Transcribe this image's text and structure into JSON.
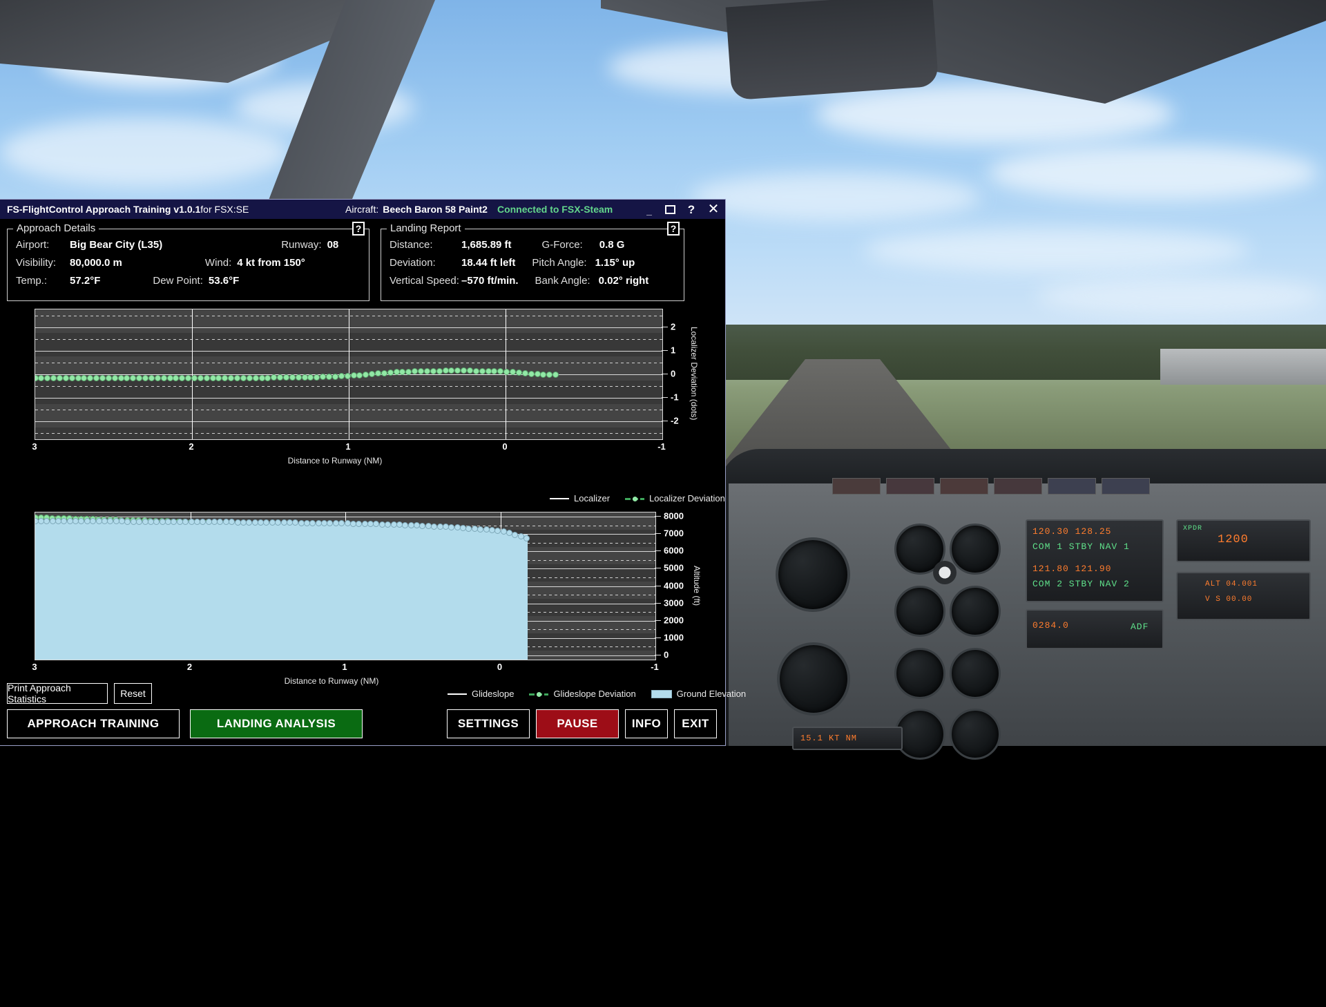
{
  "window": {
    "title_main": "FS-FlightControl Approach Training ",
    "title_version": "v1.0.1",
    "title_suffix": "for FSX:SE",
    "aircraft_label": "Aircraft:",
    "aircraft_value": "Beech Baron 58 Paint2",
    "connection_status": "Connected to FSX-Steam",
    "buttons": {
      "minimize": "_",
      "maximize": "",
      "help": "?",
      "close": "✕"
    }
  },
  "approach_details": {
    "legend": "Approach Details",
    "help": "?",
    "fields": [
      {
        "label": "Airport:",
        "value": "Big Bear City (L35)"
      },
      {
        "label": "Runway:",
        "value": "08"
      },
      {
        "label": "Visibility:",
        "value": "80,000.0 m"
      },
      {
        "label": "Wind:",
        "value": "4 kt from 150°"
      },
      {
        "label": "Temp.:",
        "value": "57.2°F"
      },
      {
        "label": "Dew Point:",
        "value": "53.6°F"
      }
    ]
  },
  "landing_report": {
    "legend": "Landing Report",
    "help": "?",
    "fields": [
      {
        "label": "Distance:",
        "value": "1,685.89 ft"
      },
      {
        "label": "G-Force:",
        "value": "0.8 G"
      },
      {
        "label": "Deviation:",
        "value": "18.44 ft left"
      },
      {
        "label": "Pitch Angle:",
        "value": "1.15° up"
      },
      {
        "label": "Vertical Speed:",
        "value": "–570 ft/min."
      },
      {
        "label": "Bank Angle:",
        "value": "0.02° right"
      }
    ]
  },
  "buttons": {
    "print_approach_statistics": "Print Approach Statistics",
    "reset": "Reset",
    "approach_training": "APPROACH TRAINING",
    "landing_analysis": "LANDING ANALYSIS",
    "settings": "SETTINGS",
    "pause": "PAUSE",
    "info": "INFO",
    "exit": "EXIT"
  },
  "colors": {
    "title_bar": "#151545",
    "connected": "#63d68c",
    "deviation_dot": "#92e8a6",
    "ground_fill": "#b3dcec",
    "landing_analysis_bg": "#0a6b12",
    "pause_bg": "#9d0d17",
    "plot_bg": "#3b3b3b"
  },
  "chart_data": [
    {
      "type": "line",
      "name": "localizer-chart",
      "title": "",
      "xlabel": "Distance to Runway (NM)",
      "ylabel": "Localizer Deviation (dots)",
      "xlim": [
        3,
        -1
      ],
      "ylim": [
        -2.75,
        2.75
      ],
      "xticks": [
        "3",
        "2",
        "1",
        "0",
        "-1"
      ],
      "xtick_values": [
        3,
        2,
        1,
        0,
        -1
      ],
      "yticks": [
        "2",
        "1",
        "0",
        "-1",
        "-2"
      ],
      "ytick_values": [
        2,
        1,
        0,
        -1,
        -2
      ],
      "grid": true,
      "legend_position": "bottom-right",
      "series": [
        {
          "name": "Localizer",
          "style": "solid-line",
          "color": "#efefef",
          "x": [
            3,
            0,
            -0.32
          ],
          "values": [
            0,
            0,
            0
          ]
        },
        {
          "name": "Localizer Deviation",
          "style": "dash-dot-markers",
          "color": "#92e8a6",
          "x": [
            3.0,
            2.88,
            2.76,
            2.64,
            2.52,
            2.4,
            2.28,
            2.16,
            2.04,
            1.92,
            1.8,
            1.68,
            1.56,
            1.44,
            1.32,
            1.2,
            1.08,
            0.96,
            0.84,
            0.72,
            0.6,
            0.48,
            0.36,
            0.24,
            0.12,
            0.0,
            -0.06,
            -0.12,
            -0.18,
            -0.24,
            -0.3,
            -0.32
          ],
          "values": [
            -0.16,
            -0.16,
            -0.16,
            -0.16,
            -0.16,
            -0.16,
            -0.16,
            -0.16,
            -0.16,
            -0.16,
            -0.16,
            -0.15,
            -0.15,
            -0.14,
            -0.13,
            -0.12,
            -0.1,
            -0.05,
            0.02,
            0.08,
            0.12,
            0.14,
            0.15,
            0.15,
            0.14,
            0.12,
            0.08,
            0.04,
            0.01,
            0.0,
            0.0,
            0.0
          ]
        }
      ]
    },
    {
      "type": "line",
      "name": "glideslope-chart",
      "title": "",
      "xlabel": "Distance to Runway (NM)",
      "ylabel": "Altitude (ft)",
      "xlim": [
        3,
        -1
      ],
      "ylim": [
        -250,
        8250
      ],
      "xticks": [
        "3",
        "2",
        "1",
        "0",
        "-1"
      ],
      "xtick_values": [
        3,
        2,
        1,
        0,
        -1
      ],
      "yticks": [
        "8000",
        "7000",
        "6000",
        "5000",
        "4000",
        "3000",
        "2000",
        "1000",
        "0"
      ],
      "ytick_values": [
        8000,
        7000,
        6000,
        5000,
        4000,
        3000,
        2000,
        1000,
        0
      ],
      "grid": true,
      "legend_position": "bottom-right",
      "series": [
        {
          "name": "Glideslope",
          "style": "solid-line",
          "color": "#efefef",
          "x": [
            3,
            -0.17
          ],
          "values": [
            7820,
            6740
          ]
        },
        {
          "name": "Glideslope Deviation",
          "style": "dash-dot-markers",
          "color": "#92e8a6",
          "x": [
            3.0,
            2.9,
            2.8,
            2.7,
            2.6,
            2.5,
            2.4,
            2.3,
            2.2,
            2.1,
            2.0,
            1.9,
            1.8,
            1.7,
            1.6,
            1.5,
            1.4,
            1.3,
            1.2,
            1.1,
            1.0,
            0.9,
            0.8,
            0.7,
            0.6,
            0.5,
            0.4,
            0.3,
            0.2,
            0.1,
            0.0,
            -0.05,
            -0.1,
            -0.15
          ],
          "values": [
            7960,
            7930,
            7900,
            7875,
            7850,
            7825,
            7800,
            7775,
            7750,
            7720,
            7690,
            7660,
            7630,
            7600,
            7570,
            7540,
            7505,
            7470,
            7430,
            7390,
            7350,
            7300,
            7250,
            7200,
            7150,
            7100,
            7050,
            7000,
            6950,
            6900,
            6860,
            6830,
            6800,
            6780
          ]
        },
        {
          "name": "Ground Elevation",
          "style": "filled-area-markers",
          "color": "#b3dcec",
          "x": [
            3.0,
            2.9,
            2.8,
            2.7,
            2.6,
            2.5,
            2.4,
            2.3,
            2.2,
            2.1,
            2.0,
            1.9,
            1.8,
            1.7,
            1.6,
            1.5,
            1.4,
            1.3,
            1.2,
            1.1,
            1.0,
            0.9,
            0.8,
            0.7,
            0.6,
            0.5,
            0.4,
            0.3,
            0.2,
            0.1,
            0.0,
            -0.05,
            -0.1,
            -0.17
          ],
          "values": [
            7760,
            7755,
            7750,
            7745,
            7740,
            7735,
            7730,
            7725,
            7720,
            7715,
            7710,
            7705,
            7700,
            7690,
            7680,
            7670,
            7660,
            7650,
            7640,
            7630,
            7620,
            7600,
            7580,
            7550,
            7520,
            7480,
            7440,
            7390,
            7330,
            7260,
            7180,
            7080,
            6960,
            6740
          ]
        }
      ]
    }
  ]
}
